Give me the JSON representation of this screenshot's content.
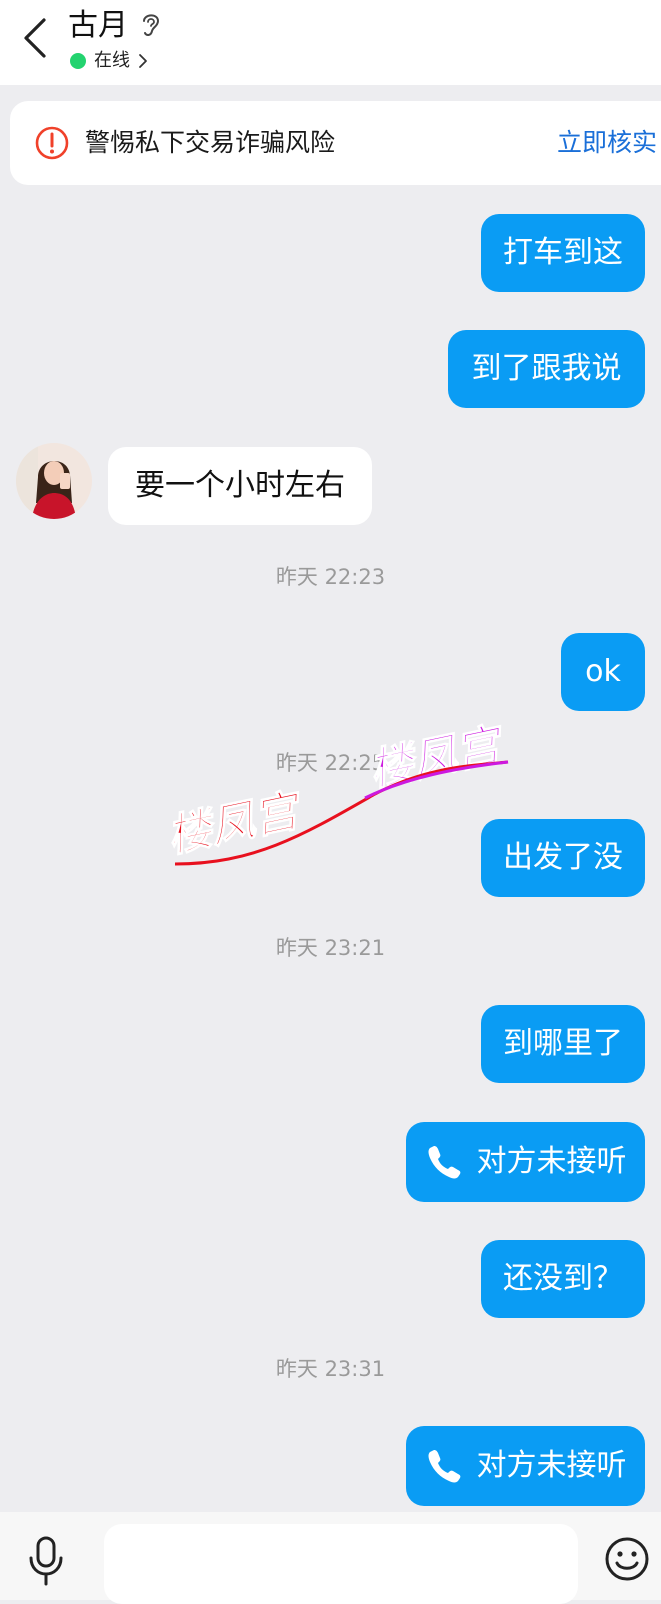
{
  "header": {
    "contact_name": "古月",
    "status": "在线",
    "icons": [
      "back-arrow-icon",
      "ear-icon",
      "chevron-right-icon"
    ],
    "status_color": "#23d36f"
  },
  "warning_banner": {
    "text": "警惕私下交易诈骗风险",
    "action": "立即核实",
    "icon": "alert-circle-icon",
    "icon_color": "#f0412a",
    "action_color": "#1a6fd8"
  },
  "messages": [
    {
      "type": "text",
      "direction": "out",
      "text": "打车到这"
    },
    {
      "type": "text",
      "direction": "out",
      "text": "到了跟我说"
    },
    {
      "type": "text",
      "direction": "in",
      "text": "要一个小时左右"
    },
    {
      "type": "timestamp",
      "text": "昨天 22:23"
    },
    {
      "type": "text",
      "direction": "out",
      "text": "ok"
    },
    {
      "type": "timestamp",
      "text": "昨天 22:25"
    },
    {
      "type": "text",
      "direction": "out",
      "text": "出发了没"
    },
    {
      "type": "timestamp",
      "text": "昨天 23:21"
    },
    {
      "type": "text",
      "direction": "out",
      "text": "到哪里了"
    },
    {
      "type": "call",
      "direction": "out",
      "text": "对方未接听",
      "icon": "phone-icon"
    },
    {
      "type": "text",
      "direction": "out",
      "text": "还没到？"
    },
    {
      "type": "timestamp",
      "text": "昨天 23:31"
    },
    {
      "type": "call",
      "direction": "out",
      "text": "对方未接听",
      "icon": "phone-icon"
    }
  ],
  "watermark": {
    "text_1": "楼凤宫",
    "text_2": "楼凤宫",
    "color_1": "#e8101e",
    "color_2": "#cc19e0"
  },
  "input_bar": {
    "placeholder": "",
    "icons": [
      "microphone-icon",
      "emoji-icon"
    ]
  },
  "colors": {
    "outgoing_bubble": "#0a9cf4",
    "incoming_bubble": "#ffffff",
    "chat_background": "#ededf0"
  }
}
